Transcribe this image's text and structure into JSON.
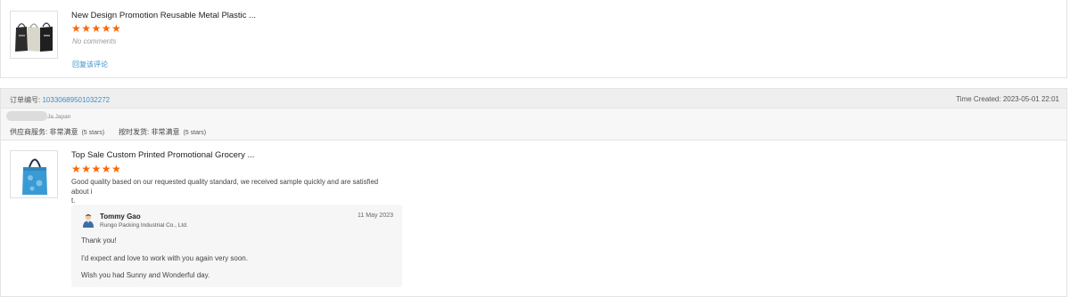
{
  "review1": {
    "title": "New Design Promotion Reusable Metal Plastic ...",
    "stars": "★★★★★",
    "comment": "No comments",
    "reply_link": "回复该评论"
  },
  "review2": {
    "order_label": "订单编号:",
    "order_number": "10330689501032272",
    "time_created": "Time Created: 2023-05-01 22:01",
    "buyer_country": "Ja.Japan",
    "supplier_service_label": "供应商服务: 非常满意",
    "supplier_service_stars": "(5 stars)",
    "ontime_label": "按时发货: 非常满意",
    "ontime_stars": "(5 stars)",
    "title": "Top Sale Custom Printed Promotional Grocery ...",
    "stars": "★★★★★",
    "comment_line1": "Good quality based on our requested quality standard, we received sample quickly and are satisfied about i",
    "comment_line2": "t.",
    "reply": {
      "name": "Tommy Gao",
      "company": "Rungo Packing Industrial Co., Ltd.",
      "date": "11 May 2023",
      "line1": "Thank you!",
      "line2": "I'd expect and love to work with you again very soon.",
      "line3": "Wish you had Sunny and Wonderful day."
    }
  },
  "colors": {
    "star": "#ff6600",
    "link": "#3a8fc7"
  }
}
